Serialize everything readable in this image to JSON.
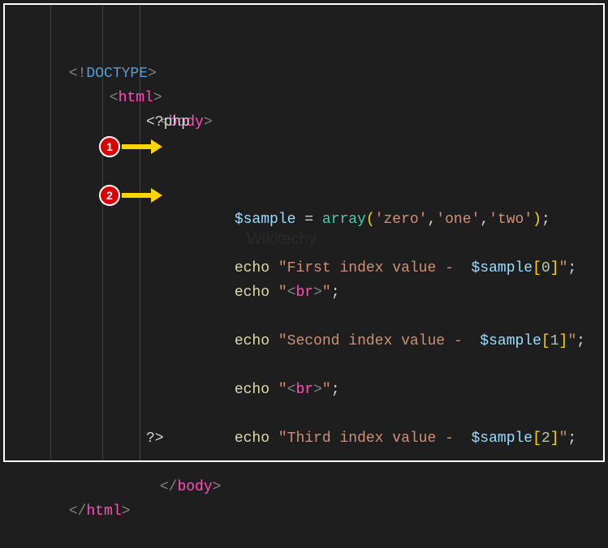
{
  "annotations": {
    "badge1": "1",
    "badge2": "2"
  },
  "code": {
    "doctype_open": "<!",
    "doctype_name": "DOCTYPE",
    "doctype_close": ">",
    "lt": "<",
    "gt": ">",
    "slash": "/",
    "html_tag": "html",
    "body_tag": "body",
    "php_open": "<?php",
    "php_close": "?>",
    "var_sample": "$sample",
    "equals": " = ",
    "array_fn": "array",
    "paren_open": "(",
    "paren_close": ")",
    "comma": ",",
    "semicolon": ";",
    "str_zero": "'zero'",
    "str_one": "'one'",
    "str_two": "'two'",
    "echo_kw": "echo",
    "space": " ",
    "dq": "\"",
    "first_text": "First index value -  ",
    "second_text": "Second index value -  ",
    "third_text": "Third index value -  ",
    "bracket_open": "[",
    "bracket_close": "]",
    "idx0": "0",
    "idx1": "1",
    "idx2": "2",
    "br_open": "<",
    "br_tag": "br",
    "br_close": ">"
  },
  "watermark": "Wikitechy"
}
